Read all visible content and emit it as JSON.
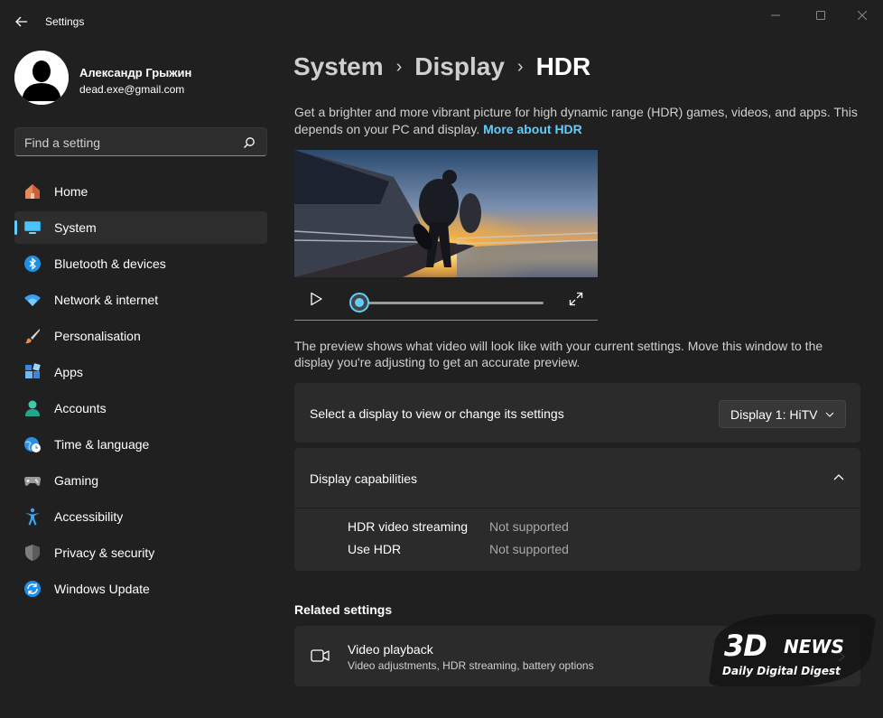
{
  "app": {
    "title": "Settings"
  },
  "profile": {
    "name": "Александр Грыжин",
    "email": "dead.exe@gmail.com"
  },
  "search": {
    "placeholder": "Find a setting"
  },
  "nav": {
    "items": [
      {
        "label": "Home",
        "icon": "home-icon"
      },
      {
        "label": "System",
        "icon": "system-icon",
        "active": true
      },
      {
        "label": "Bluetooth & devices",
        "icon": "bluetooth-icon"
      },
      {
        "label": "Network & internet",
        "icon": "wifi-icon"
      },
      {
        "label": "Personalisation",
        "icon": "brush-icon"
      },
      {
        "label": "Apps",
        "icon": "apps-icon"
      },
      {
        "label": "Accounts",
        "icon": "accounts-icon"
      },
      {
        "label": "Time & language",
        "icon": "globe-clock-icon"
      },
      {
        "label": "Gaming",
        "icon": "gamepad-icon"
      },
      {
        "label": "Accessibility",
        "icon": "accessibility-icon"
      },
      {
        "label": "Privacy & security",
        "icon": "shield-icon"
      },
      {
        "label": "Windows Update",
        "icon": "update-icon"
      }
    ]
  },
  "breadcrumb": {
    "level1": "System",
    "level2": "Display",
    "current": "HDR",
    "separator": "›"
  },
  "description": {
    "text": "Get a brighter and more vibrant picture for high dynamic range (HDR) games, videos, and apps. This depends on your PC and display.",
    "link": "More about HDR"
  },
  "player": {
    "progress": 0.0
  },
  "preview_note": "The preview shows what video will look like with your current settings. Move this window to the display you're adjusting to get an accurate preview.",
  "display_select": {
    "label": "Select a display to view or change its settings",
    "value": "Display 1: HiTV"
  },
  "capabilities": {
    "title": "Display capabilities",
    "rows": [
      {
        "key": "HDR video streaming",
        "value": "Not supported"
      },
      {
        "key": "Use HDR",
        "value": "Not supported"
      }
    ]
  },
  "related": {
    "title": "Related settings",
    "video_playback": {
      "title": "Video playback",
      "subtitle": "Video adjustments, HDR streaming, battery options"
    }
  },
  "watermark": {
    "brand_3d": "3D",
    "brand_news": "NEWS",
    "tagline": "Daily Digital Digest"
  },
  "colors": {
    "accent": "#60cdff",
    "background": "#202020",
    "card": "#2b2b2b"
  }
}
